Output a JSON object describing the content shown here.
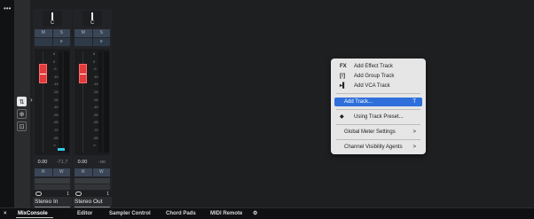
{
  "left_bar": {
    "menu_icon": "more-dots-icon"
  },
  "left_icons": [
    {
      "icon": "inspector-icon"
    },
    {
      "icon": "routing-icon"
    },
    {
      "icon": "channel-icon"
    }
  ],
  "strips": [
    {
      "pan": "C",
      "row1": [
        "M",
        "S"
      ],
      "row2": [
        "",
        "e"
      ],
      "scale": [
        "6",
        "0",
        "-5",
        "-10",
        "-15",
        "-20",
        "-30",
        "-40",
        "-50",
        "-60",
        "-70",
        "-80",
        "∞"
      ],
      "volume": "0.00",
      "peak": "-71.7",
      "rw": [
        "R",
        "W"
      ],
      "routing_number": "1",
      "name": "Stereo In"
    },
    {
      "pan": "C",
      "row1": [
        "M",
        "S"
      ],
      "row2": [
        "",
        "e"
      ],
      "scale": [
        "6",
        "0",
        "-5",
        "-10",
        "-15",
        "-20",
        "-30",
        "-40",
        "-50",
        "-60",
        "-70",
        "-80",
        "∞"
      ],
      "volume": "0.00",
      "peak": "-oo",
      "rw": [
        "R",
        "W"
      ],
      "routing_number": "1",
      "name": "Stereo Out"
    }
  ],
  "context_menu": {
    "items": [
      {
        "icon_text": "FX",
        "label": "Add Effect Track",
        "arrow": ""
      },
      {
        "icon_text": "[!]",
        "label": "Add Group Track",
        "arrow": ""
      },
      {
        "icon_text": "▸▌",
        "label": "Add VCA Track",
        "arrow": ""
      },
      {
        "icon_text": "",
        "label": "Add Track...",
        "arrow": "T"
      },
      {
        "icon_text": "◆",
        "label": "Using Track Preset...",
        "arrow": ""
      },
      {
        "icon_text": "",
        "label": "Global Meter Settings",
        "arrow": ">"
      },
      {
        "icon_text": "",
        "label": "Channel Visibility Agents",
        "arrow": ">"
      }
    ]
  },
  "bottom_tabs": {
    "close": "×",
    "tabs": [
      "MixConsole",
      "Editor",
      "Sampler Control",
      "Chord Pads",
      "MIDI Remote"
    ],
    "settings_icon": "⚙"
  },
  "colors": {
    "accent": "#2e6fdc",
    "fader": "#e33b3b",
    "meter_peak": "#33c6e8"
  }
}
